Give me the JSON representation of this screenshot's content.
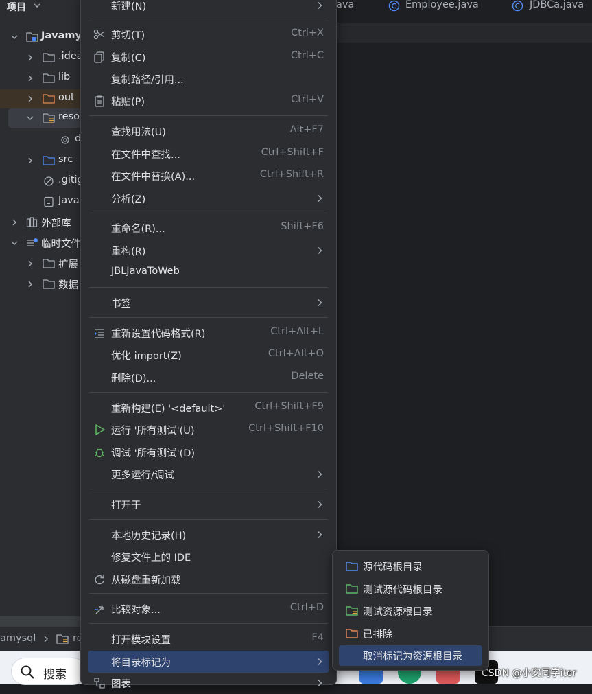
{
  "project_panel": {
    "title": "项目",
    "tree": [
      {
        "label": "Javamy",
        "icon": "module-folder-icon",
        "arrow": "down",
        "bold": true
      },
      {
        "label": ".idea",
        "icon": "folder-icon",
        "arrow": "right"
      },
      {
        "label": "lib",
        "icon": "folder-icon",
        "arrow": "right"
      },
      {
        "label": "out",
        "icon": "excluded-folder-icon",
        "arrow": "right"
      },
      {
        "label": "reso",
        "icon": "resources-folder-icon",
        "arrow": "down"
      },
      {
        "label": "d",
        "icon": "gear-file-icon"
      },
      {
        "label": "src",
        "icon": "source-folder-icon",
        "arrow": "right"
      },
      {
        "label": ".gitig",
        "icon": "ignore-file-icon"
      },
      {
        "label": "Javar",
        "icon": "iml-file-icon"
      },
      {
        "label": "外部库",
        "icon": "library-icon",
        "arrow": "right"
      },
      {
        "label": "临时文件",
        "icon": "scratches-icon",
        "arrow": "down"
      },
      {
        "label": "扩展",
        "icon": "folder-icon",
        "arrow": "right"
      },
      {
        "label": "数据",
        "icon": "folder-icon",
        "arrow": "right"
      }
    ]
  },
  "editor_tabs": [
    {
      "label": "ava",
      "icon": ""
    },
    {
      "label": "Employee.java",
      "icon": "class-icon"
    },
    {
      "label": "JDBCa.java",
      "icon": "class-icon"
    }
  ],
  "context_menu": {
    "items": [
      {
        "label": "新建(N)",
        "shortcut": "",
        "submenu": true,
        "icon": ""
      },
      {
        "label": "剪切(T)",
        "shortcut": "Ctrl+X",
        "icon": "scissors-icon"
      },
      {
        "label": "复制(C)",
        "shortcut": "Ctrl+C",
        "icon": "copy-icon"
      },
      {
        "label": "复制路径/引用...",
        "shortcut": "",
        "icon": ""
      },
      {
        "label": "粘贴(P)",
        "shortcut": "Ctrl+V",
        "icon": "paste-icon"
      },
      {
        "label": "查找用法(U)",
        "shortcut": "Alt+F7",
        "icon": ""
      },
      {
        "label": "在文件中查找...",
        "shortcut": "Ctrl+Shift+F",
        "icon": ""
      },
      {
        "label": "在文件中替换(A)...",
        "shortcut": "Ctrl+Shift+R",
        "icon": ""
      },
      {
        "label": "分析(Z)",
        "shortcut": "",
        "submenu": true,
        "icon": ""
      },
      {
        "label": "重命名(R)...",
        "shortcut": "Shift+F6",
        "icon": ""
      },
      {
        "label": "重构(R)",
        "shortcut": "",
        "submenu": true,
        "icon": ""
      },
      {
        "label": "JBLJavaToWeb",
        "shortcut": "",
        "icon": ""
      },
      {
        "label": "书签",
        "shortcut": "",
        "submenu": true,
        "icon": ""
      },
      {
        "label": "重新设置代码格式(R)",
        "shortcut": "Ctrl+Alt+L",
        "icon": "reformat-icon"
      },
      {
        "label": "优化 import(Z)",
        "shortcut": "Ctrl+Alt+O",
        "icon": ""
      },
      {
        "label": "删除(D)...",
        "shortcut": "Delete",
        "icon": ""
      },
      {
        "label": "重新构建(E) '<default>'",
        "shortcut": "Ctrl+Shift+F9",
        "icon": ""
      },
      {
        "label": "运行 '所有测试'(U)",
        "shortcut": "Ctrl+Shift+F10",
        "icon": "run-icon"
      },
      {
        "label": "调试 '所有测试'(D)",
        "shortcut": "",
        "icon": "debug-bug-icon"
      },
      {
        "label": "更多运行/调试",
        "shortcut": "",
        "submenu": true,
        "icon": ""
      },
      {
        "label": "打开于",
        "shortcut": "",
        "submenu": true,
        "icon": ""
      },
      {
        "label": "本地历史记录(H)",
        "shortcut": "",
        "submenu": true,
        "icon": ""
      },
      {
        "label": "修复文件上的 IDE",
        "shortcut": "",
        "icon": ""
      },
      {
        "label": "从磁盘重新加载",
        "shortcut": "",
        "icon": "reload-icon"
      },
      {
        "label": "比较对象...",
        "shortcut": "Ctrl+D",
        "icon": "compare-icon"
      },
      {
        "label": "打开模块设置",
        "shortcut": "F4",
        "icon": ""
      },
      {
        "label": "将目录标记为",
        "shortcut": "",
        "submenu": true,
        "icon": "",
        "active": true
      },
      {
        "label": "图表",
        "shortcut": "",
        "submenu": true,
        "icon": "diagram-icon"
      }
    ]
  },
  "submenu": {
    "items": [
      {
        "label": "源代码根目录",
        "icon": "source-root-folder-icon",
        "color": "#548af7"
      },
      {
        "label": "测试源代码根目录",
        "icon": "test-source-folder-icon",
        "color": "#5fb865"
      },
      {
        "label": "测试资源根目录",
        "icon": "test-resources-folder-icon",
        "color": "#5fb865"
      },
      {
        "label": "已排除",
        "icon": "excluded-folder-icon",
        "color": "#e08855"
      },
      {
        "label": "取消标记为资源根目录",
        "icon": "",
        "active": true
      }
    ]
  },
  "breadcrumb": {
    "module": "amysql",
    "folder": "re"
  },
  "taskbar": {
    "search_placeholder": "搜索"
  },
  "watermark": "CSDN @小安同学iter"
}
